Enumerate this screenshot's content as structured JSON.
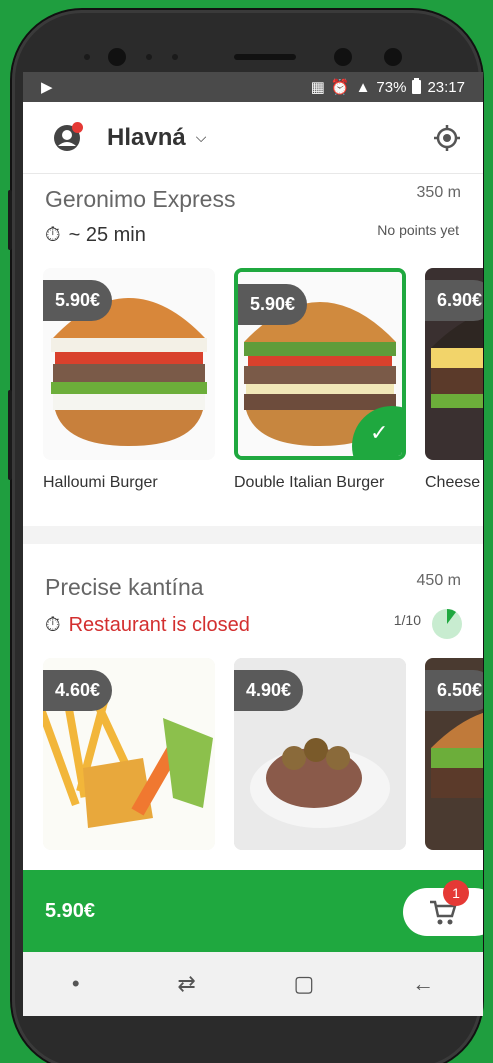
{
  "status": {
    "time": "23:17",
    "battery": "73%"
  },
  "header": {
    "title": "Hlavná"
  },
  "restaurants": [
    {
      "name": "Geronimo Express",
      "distance": "350 m",
      "time": "~ 25 min",
      "points": "No points yet",
      "items": [
        {
          "price": "5.90€",
          "name": "Halloumi Burger"
        },
        {
          "price": "5.90€",
          "name": "Double Italian Burger"
        },
        {
          "price": "6.90€",
          "name": "Cheese"
        }
      ]
    },
    {
      "name": "Precise kantína",
      "distance": "450 m",
      "time": "Restaurant is closed",
      "points": "1/10",
      "items": [
        {
          "price": "4.60€"
        },
        {
          "price": "4.90€"
        },
        {
          "price": "6.50€"
        }
      ]
    }
  ],
  "cart": {
    "total": "5.90€",
    "count": "1"
  },
  "colors": {
    "accent": "#1fa83f",
    "badge": "#e53935",
    "closed": "#d32f2f"
  }
}
